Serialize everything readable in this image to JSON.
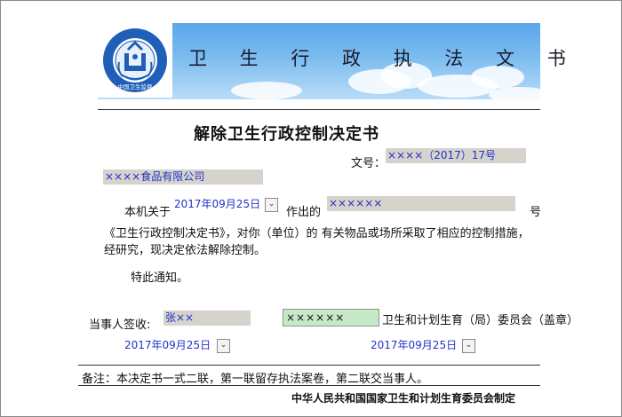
{
  "header": {
    "title": "卫 生 行 政 执 法 文 书"
  },
  "emblem": {
    "ring_text": "CHINA NATIONAL HEALTH INSPECTION",
    "bottom_text": "中国卫生监督"
  },
  "document": {
    "title": "解除卫生行政控制决定书"
  },
  "doc_no": {
    "label": "文号：",
    "value": "××××（2017）17号"
  },
  "company": {
    "value": "××××食品有限公司"
  },
  "decision_line": {
    "prefix": "本机关于",
    "date": "2017年09月25日",
    "made_label": "作出的",
    "number": "××××××",
    "suffix": "号"
  },
  "body": {
    "line1": "《卫生行政控制决定书》，对你（单位）的 有关物品或场所采取了相应的控制措施，",
    "line2": "经研究，现决定依法解除控制。",
    "notice": "特此通知。"
  },
  "party": {
    "label": "当事人签收:",
    "value": "张××",
    "date": "2017年09月25日"
  },
  "authority": {
    "value": "××××××",
    "suffix": "卫生和计划生育（局）委员会（盖章）",
    "date": "2017年09月25日"
  },
  "footer": {
    "note": "备注：本决定书一式二联，第一联留存执法案卷，第二联交当事人。",
    "issuer": "中华人民共和国国家卫生和计划生育委员会制定"
  },
  "colors": {
    "field_bg": "#d6d2cc",
    "field_text": "#2333c9",
    "highlight": "#c7e8c7",
    "sky": "#5aa7ea"
  },
  "icons": {
    "dropdown": "chevron-down-icon",
    "emblem": "health-inspection-emblem-icon"
  }
}
